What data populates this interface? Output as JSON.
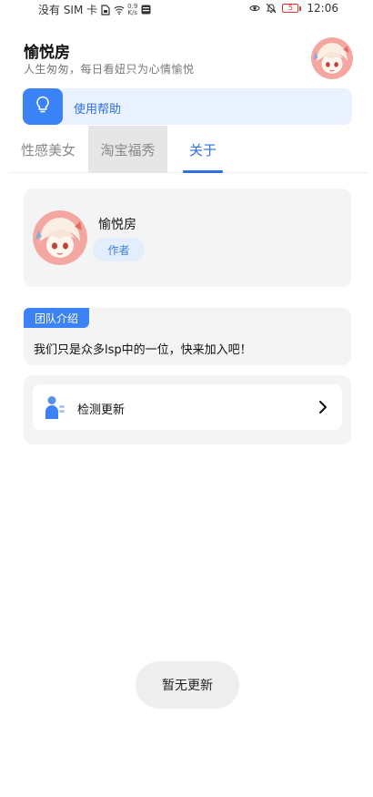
{
  "status_bar": {
    "carrier": "没有 SIM 卡",
    "speed_value": "0.9",
    "speed_unit": "K/s",
    "battery": "5",
    "time": "12:06"
  },
  "header": {
    "title": "愉悦房",
    "subtitle": "人生匆匆，每日看妞只为心情愉悦"
  },
  "help": {
    "label": "使用帮助",
    "icon": "lightbulb-icon"
  },
  "tabs": [
    {
      "label": "性感美女",
      "state": "normal"
    },
    {
      "label": "淘宝福秀",
      "state": "pressed"
    },
    {
      "label": "关于",
      "state": "active"
    }
  ],
  "author": {
    "name": "愉悦房",
    "tag": "作者"
  },
  "team": {
    "badge": "团队介绍",
    "text": "我们只是众多lsp中的一位，快来加入吧！"
  },
  "update": {
    "label": "检测更新",
    "icon": "person-icon"
  },
  "toast": {
    "text": "暂无更新"
  },
  "colors": {
    "accent": "#3b82f6",
    "accent_text": "#2f6fe0",
    "card_bg": "#f4f4f4",
    "help_bg": "#e9f2fe"
  }
}
